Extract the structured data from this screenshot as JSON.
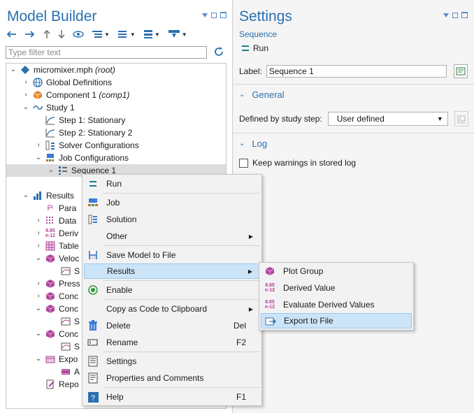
{
  "model_builder": {
    "title": "Model Builder",
    "filter_placeholder": "Type filter text",
    "toolbar": [
      "back-arrow-icon",
      "forward-arrow-icon",
      "up-arrow-icon",
      "down-arrow-icon",
      "show-icon",
      "expand-sections-icon",
      "collapse-sections-icon",
      "more-icon",
      "build-icon"
    ],
    "tree": [
      {
        "label": "micromixer.mph",
        "suffix": "(root)",
        "icon": "model-root-icon"
      },
      {
        "label": "Global Definitions",
        "icon": "globe-icon"
      },
      {
        "label": "Component 1",
        "suffix": "(comp1)",
        "icon": "component-icon"
      },
      {
        "label": "Study 1",
        "icon": "study-icon"
      },
      {
        "label": "Step 1: Stationary",
        "icon": "stationary-step-icon"
      },
      {
        "label": "Step 2: Stationary 2",
        "icon": "stationary-step-icon"
      },
      {
        "label": "Solver Configurations",
        "icon": "solver-configurations-icon"
      },
      {
        "label": "Job Configurations",
        "icon": "job-configurations-icon"
      },
      {
        "label": "Sequence 1",
        "icon": "sequence-icon"
      },
      {
        "label": "Results",
        "icon": "results-icon"
      },
      {
        "label": "Para",
        "icon": "parameters-icon"
      },
      {
        "label": "Data",
        "icon": "datasets-icon"
      },
      {
        "label": "Deriv",
        "icon": "derived-values-icon"
      },
      {
        "label": "Table",
        "icon": "tables-icon"
      },
      {
        "label": "Veloc",
        "icon": "plot-group-icon"
      },
      {
        "label": "S",
        "icon": "surface-icon"
      },
      {
        "label": "Press",
        "icon": "plot-group-3d-icon"
      },
      {
        "label": "Conc",
        "icon": "plot-group-3d-icon"
      },
      {
        "label": "Conc",
        "icon": "plot-group-icon"
      },
      {
        "label": "S",
        "icon": "surface-icon"
      },
      {
        "label": "Conc",
        "icon": "plot-group-icon"
      },
      {
        "label": "S",
        "icon": "surface-icon"
      },
      {
        "label": "Expo",
        "icon": "export-icon"
      },
      {
        "label": "A",
        "icon": "animation-icon"
      },
      {
        "label": "Repo",
        "icon": "reports-icon"
      }
    ]
  },
  "settings": {
    "title": "Settings",
    "subtitle": "Sequence",
    "run_label": "Run",
    "label_caption": "Label:",
    "label_value": "Sequence 1",
    "general_header": "General",
    "defined_caption": "Defined by study step:",
    "defined_value": "User defined",
    "log_header": "Log",
    "log_checkbox": "Keep warnings in stored log",
    "log_checked": false
  },
  "context_menu": [
    {
      "label": "Run",
      "icon": "run-icon"
    },
    {
      "label": "Job",
      "icon": "job-icon"
    },
    {
      "label": "Solution",
      "icon": "solution-icon"
    },
    {
      "label": "Other",
      "icon": "",
      "arrow": true
    },
    {
      "label": "Save Model to File",
      "icon": "save-model-icon"
    },
    {
      "label": "Results",
      "icon": "",
      "arrow": true,
      "highlighted": true
    },
    {
      "label": "Enable",
      "icon": "enable-icon"
    },
    {
      "label": "Copy as Code to Clipboard",
      "icon": "",
      "arrow": true
    },
    {
      "label": "Delete",
      "icon": "delete-icon",
      "shortcut": "Del"
    },
    {
      "label": "Rename",
      "icon": "rename-icon",
      "shortcut": "F2"
    },
    {
      "label": "Settings",
      "icon": "settings-icon"
    },
    {
      "label": "Properties and Comments",
      "icon": "properties-icon"
    },
    {
      "label": "Help",
      "icon": "help-icon",
      "shortcut": "F1"
    }
  ],
  "submenu": [
    {
      "label": "Plot Group",
      "icon": "plot-group-icon"
    },
    {
      "label": "Derived Value",
      "icon": "derived-value-icon"
    },
    {
      "label": "Evaluate Derived Values",
      "icon": "evaluate-derived-values-icon"
    },
    {
      "label": "Export to File",
      "icon": "export-to-file-icon",
      "highlighted": true
    }
  ],
  "colors": {
    "accent": "#2a6fb0",
    "highlight": "#cce4f7",
    "selected_row": "#dcdcdc"
  }
}
